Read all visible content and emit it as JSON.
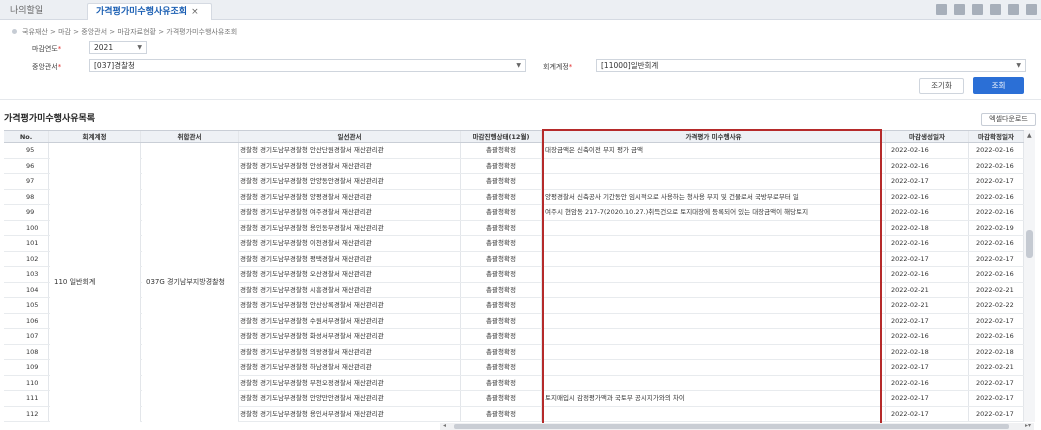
{
  "tabs": [
    {
      "label": "나의할일"
    },
    {
      "label": "가격평가미수행사유조회",
      "close": "×"
    }
  ],
  "breadcrumb": "국유재산 > 마감 > 중앙관서 > 마감자료현황 > 가격평가미수행사유조회",
  "filters": {
    "year_label": "마감연도",
    "year_value": "2021",
    "agency_label": "중앙관서",
    "agency_value": "[037]경찰청",
    "account_label": "회계계정",
    "account_value": "[11000]일반회계",
    "required_mark": "*"
  },
  "buttons": {
    "reset": "조기화",
    "search": "조회",
    "excel": "엑셀다운로드"
  },
  "list_title": "가격평가미수행사유목록",
  "columns": [
    "No.",
    "회계계정",
    "취합관서",
    "일선관서",
    "마감진행상태(12월)",
    "가격평가 미수행사유",
    "마감생성일자",
    "마감확정일자"
  ],
  "merged": {
    "account": "110 일반회계",
    "org": "037G 경기남부지방경찰청"
  },
  "rows": [
    {
      "no": "95",
      "gen": "경찰청 경기도남부경찰청 안산단원경찰서 재산관리관",
      "status": "총괄청확정",
      "reason": "대장금액은 신축이전 부지 평가 금액",
      "made": "2022-02-16",
      "conf": "2022-02-16"
    },
    {
      "no": "96",
      "gen": "경찰청 경기도남부경찰청 안성경찰서 재산관리관",
      "status": "총괄청확정",
      "reason": "",
      "made": "2022-02-16",
      "conf": "2022-02-16"
    },
    {
      "no": "97",
      "gen": "경찰청 경기도남부경찰청 안양동안경찰서 재산관리관",
      "status": "총괄청확정",
      "reason": "",
      "made": "2022-02-17",
      "conf": "2022-02-17"
    },
    {
      "no": "98",
      "gen": "경찰청 경기도남부경찰청 양평경찰서 재산관리관",
      "status": "총괄청확정",
      "reason": "양평경찰서 신축공사 기간동안 임시적으로 사용하는 청사용 부지 및 건물로서 국방부로부터 일",
      "made": "2022-02-16",
      "conf": "2022-02-16"
    },
    {
      "no": "99",
      "gen": "경찰청 경기도남부경찰청 여주경찰서 재산관리관",
      "status": "총괄청확정",
      "reason": "여주시 현암동 217-7(2020.10.27.)취득건으로 토지대장에 등록되어 있는 대장금액이 해당토지",
      "made": "2022-02-16",
      "conf": "2022-02-16"
    },
    {
      "no": "100",
      "gen": "경찰청 경기도남부경찰청 용인동부경찰서 재산관리관",
      "status": "총괄청확정",
      "reason": "",
      "made": "2022-02-18",
      "conf": "2022-02-19"
    },
    {
      "no": "101",
      "gen": "경찰청 경기도남부경찰청 이천경찰서 재산관리관",
      "status": "총괄청확정",
      "reason": "",
      "made": "2022-02-16",
      "conf": "2022-02-16"
    },
    {
      "no": "102",
      "gen": "경찰청 경기도남부경찰청 평택경찰서 재산관리관",
      "status": "총괄청확정",
      "reason": "",
      "made": "2022-02-17",
      "conf": "2022-02-17"
    },
    {
      "no": "103",
      "gen": "경찰청 경기도남부경찰청 오산경찰서 재산관리관",
      "status": "총괄청확정",
      "reason": "",
      "made": "2022-02-16",
      "conf": "2022-02-16"
    },
    {
      "no": "104",
      "gen": "경찰청 경기도남부경찰청 시흥경찰서 재산관리관",
      "status": "총괄청확정",
      "reason": "",
      "made": "2022-02-21",
      "conf": "2022-02-21"
    },
    {
      "no": "105",
      "gen": "경찰청 경기도남부경찰청 안산상록경찰서 재산관리관",
      "status": "총괄청확정",
      "reason": "",
      "made": "2022-02-21",
      "conf": "2022-02-22"
    },
    {
      "no": "106",
      "gen": "경찰청 경기도남부경찰청 수원서부경찰서 재산관리관",
      "status": "총괄청확정",
      "reason": "",
      "made": "2022-02-17",
      "conf": "2022-02-17"
    },
    {
      "no": "107",
      "gen": "경찰청 경기도남부경찰청 화성서부경찰서 재산관리관",
      "status": "총괄청확정",
      "reason": "",
      "made": "2022-02-16",
      "conf": "2022-02-16"
    },
    {
      "no": "108",
      "gen": "경찰청 경기도남부경찰청 의왕경찰서 재산관리관",
      "status": "총괄청확정",
      "reason": "",
      "made": "2022-02-18",
      "conf": "2022-02-18"
    },
    {
      "no": "109",
      "gen": "경찰청 경기도남부경찰청 하남경찰서 재산관리관",
      "status": "총괄청확정",
      "reason": "",
      "made": "2022-02-17",
      "conf": "2022-02-21"
    },
    {
      "no": "110",
      "gen": "경찰청 경기도남부경찰청 부천오정경찰서 재산관리관",
      "status": "총괄청확정",
      "reason": "",
      "made": "2022-02-16",
      "conf": "2022-02-17"
    },
    {
      "no": "111",
      "gen": "경찰청 경기도남부경찰청 안양만안경찰서 재산관리관",
      "status": "총괄청확정",
      "reason": "토지매입시 감정평가액과 국토부 공시지가와의 차이",
      "made": "2022-02-17",
      "conf": "2022-02-17"
    },
    {
      "no": "112",
      "gen": "경찰청 경기도남부경찰청 용인서부경찰서 재산관리관",
      "status": "총괄청확정",
      "reason": "",
      "made": "2022-02-17",
      "conf": "2022-02-17"
    }
  ]
}
